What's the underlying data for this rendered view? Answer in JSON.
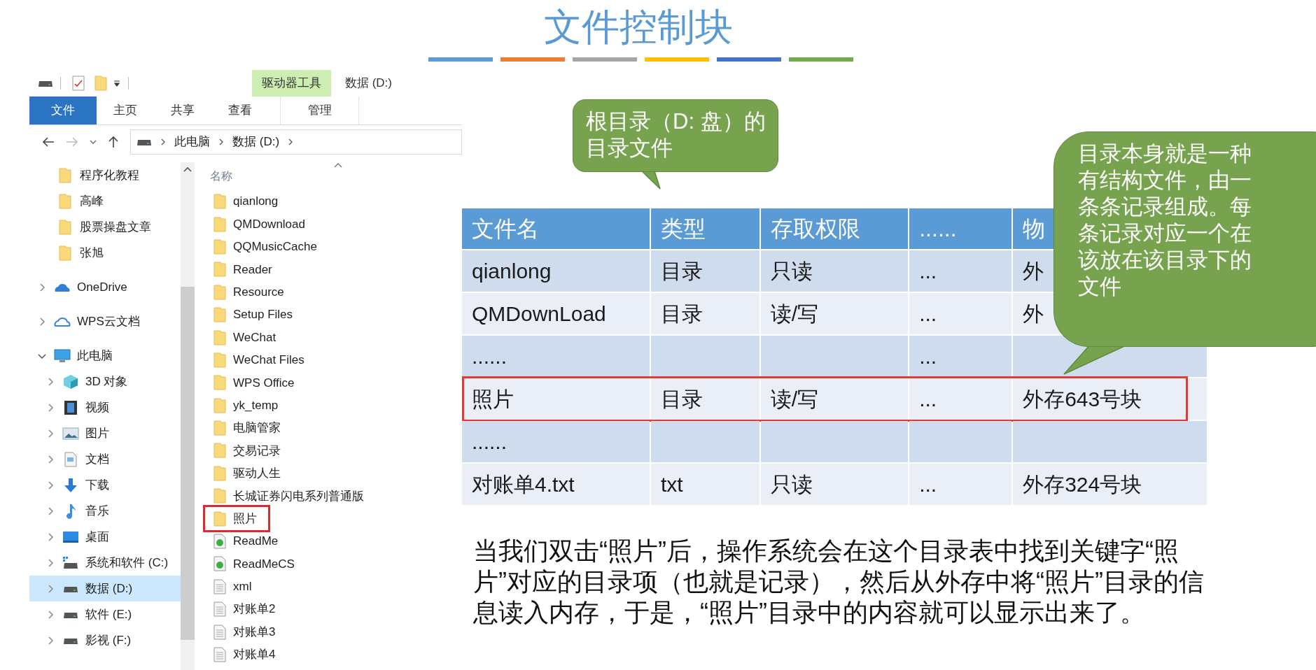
{
  "slide": {
    "title": "文件控制块"
  },
  "explorer": {
    "window_title": "数据 (D:)",
    "context_group": "驱动器工具",
    "tabs": [
      {
        "label": "文件",
        "kind": "file",
        "selected": false
      },
      {
        "label": "主页",
        "kind": "normal",
        "selected": false
      },
      {
        "label": "共享",
        "kind": "normal",
        "selected": false
      },
      {
        "label": "查看",
        "kind": "normal",
        "selected": false
      },
      {
        "label": "管理",
        "kind": "context",
        "selected": false
      }
    ],
    "breadcrumbs": [
      "此电脑",
      "数据 (D:)"
    ],
    "nav": [
      {
        "label": "程序化教程",
        "kind": "folder",
        "selected": false
      },
      {
        "label": "高峰",
        "kind": "folder",
        "selected": false
      },
      {
        "label": "股票操盘文章",
        "kind": "folder",
        "selected": false
      },
      {
        "label": "张旭",
        "kind": "folder",
        "selected": false
      },
      {
        "label": "OneDrive",
        "kind": "cloud",
        "expanded": false,
        "selected": false
      },
      {
        "label": "WPS云文档",
        "kind": "cloud-outline",
        "expanded": false,
        "selected": false
      },
      {
        "label": "此电脑",
        "kind": "pc",
        "expanded": true,
        "selected": false,
        "children": [
          {
            "label": "3D 对象",
            "kind": "cube",
            "expanded": false,
            "selected": false
          },
          {
            "label": "视频",
            "kind": "video",
            "expanded": false,
            "selected": false
          },
          {
            "label": "图片",
            "kind": "image",
            "expanded": false,
            "selected": false
          },
          {
            "label": "文档",
            "kind": "doc",
            "expanded": false,
            "selected": false
          },
          {
            "label": "下载",
            "kind": "download",
            "expanded": false,
            "selected": false
          },
          {
            "label": "音乐",
            "kind": "music",
            "expanded": false,
            "selected": false
          },
          {
            "label": "桌面",
            "kind": "desktop",
            "expanded": false,
            "selected": false
          },
          {
            "label": "系统和软件 (C:)",
            "kind": "system-drive",
            "expanded": false,
            "selected": false
          },
          {
            "label": "数据 (D:)",
            "kind": "drive",
            "expanded": false,
            "selected": true
          },
          {
            "label": "软件 (E:)",
            "kind": "drive",
            "expanded": false,
            "selected": false
          },
          {
            "label": "影视 (F:)",
            "kind": "drive",
            "expanded": false,
            "selected": false
          }
        ]
      }
    ],
    "column_header": "名称",
    "files": [
      {
        "name": "qianlong",
        "kind": "folder",
        "highlighted": false
      },
      {
        "name": "QMDownload",
        "kind": "folder",
        "highlighted": false
      },
      {
        "name": "QQMusicCache",
        "kind": "folder",
        "highlighted": false
      },
      {
        "name": "Reader",
        "kind": "folder",
        "highlighted": false
      },
      {
        "name": "Resource",
        "kind": "folder",
        "highlighted": false
      },
      {
        "name": "Setup Files",
        "kind": "folder",
        "highlighted": false
      },
      {
        "name": "WeChat",
        "kind": "folder",
        "highlighted": false
      },
      {
        "name": "WeChat Files",
        "kind": "folder",
        "highlighted": false
      },
      {
        "name": "WPS Office",
        "kind": "folder",
        "highlighted": false
      },
      {
        "name": "yk_temp",
        "kind": "folder",
        "highlighted": false
      },
      {
        "name": "电脑管家",
        "kind": "folder",
        "highlighted": false
      },
      {
        "name": "交易记录",
        "kind": "folder",
        "highlighted": false
      },
      {
        "name": "驱动人生",
        "kind": "folder",
        "highlighted": false
      },
      {
        "name": "长城证券闪电系列普通版",
        "kind": "folder",
        "highlighted": false
      },
      {
        "name": "照片",
        "kind": "folder",
        "highlighted": true
      },
      {
        "name": "ReadMe",
        "kind": "web",
        "highlighted": false
      },
      {
        "name": "ReadMeCS",
        "kind": "web",
        "highlighted": false
      },
      {
        "name": "xml",
        "kind": "text",
        "highlighted": false
      },
      {
        "name": "对账单2",
        "kind": "text",
        "highlighted": false
      },
      {
        "name": "对账单3",
        "kind": "text",
        "highlighted": false
      },
      {
        "name": "对账单4",
        "kind": "text",
        "highlighted": false
      }
    ]
  },
  "callouts": [
    {
      "text": "根目录（D: 盘）的目录文件"
    },
    {
      "text": "目录本身就是一种有结构文件，由一条条记录组成。每条记录对应一个在该放在该目录下的文件"
    }
  ],
  "table": {
    "columns": [
      "文件名",
      "类型",
      "存取权限",
      "......",
      "物"
    ],
    "rows": [
      {
        "cells": [
          "qianlong",
          "目录",
          "只读",
          "...",
          "外"
        ],
        "highlighted": false
      },
      {
        "cells": [
          "QMDownLoad",
          "目录",
          "读/写",
          "...",
          "外"
        ],
        "highlighted": false
      },
      {
        "cells": [
          "......",
          "",
          "",
          "...",
          ""
        ],
        "highlighted": false
      },
      {
        "cells": [
          "照片",
          "目录",
          "读/写",
          "...",
          "外存643号块"
        ],
        "highlighted": true
      },
      {
        "cells": [
          "......",
          "",
          "",
          "",
          ""
        ],
        "highlighted": false
      },
      {
        "cells": [
          "对账单4.txt",
          "txt",
          "只读",
          "...",
          "外存324号块"
        ],
        "highlighted": false
      }
    ]
  },
  "paragraph": "当我们双击“照片”后，操作系统会在这个目录表中找到关键字“照片”对应的目录项（也就是记录），然后从外存中将“照片”目录的信息读入内存，于是，“照片”目录中的内容就可以显示出来了。"
}
